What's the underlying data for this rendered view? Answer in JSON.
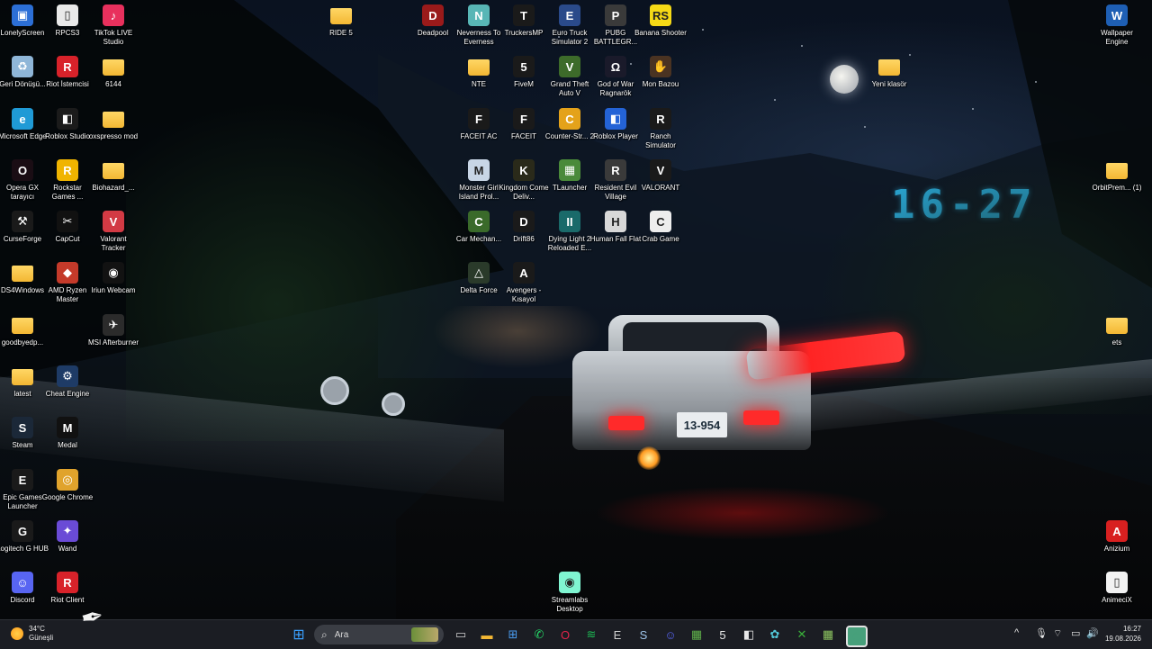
{
  "wallpaper": {
    "clock_widget": "16-27",
    "plate": "13-954"
  },
  "desktop": {
    "icons": [
      {
        "label": "LonelyScreen",
        "icon": "monitor-icon",
        "color": "#2c6fd6",
        "glyph": "▣"
      },
      {
        "label": "RPCS3",
        "icon": "file-icon",
        "color": "#e9e9e9",
        "glyph": "▯"
      },
      {
        "label": "TikTok LIVE Studio",
        "icon": "tiktok-icon",
        "color": "#e8305d",
        "glyph": "♪"
      },
      {
        "label": "Geri Dönüşü...",
        "icon": "recycle-bin-icon",
        "color": "#8fb6d8",
        "glyph": "♻"
      },
      {
        "label": "Riot İstemcisi",
        "icon": "riot-icon",
        "color": "#d8222a",
        "glyph": "R"
      },
      {
        "label": "6144",
        "icon": "folder-icon",
        "color": "#f3b733",
        "glyph": ""
      },
      {
        "label": "Microsoft Edge",
        "icon": "edge-icon",
        "color": "#1f9ad6",
        "glyph": "e"
      },
      {
        "label": "Roblox Studio",
        "icon": "roblox-studio-icon",
        "color": "#1b1b1b",
        "glyph": "◧"
      },
      {
        "label": "oxspresso mod",
        "icon": "folder-icon",
        "color": "#f3b733",
        "glyph": ""
      },
      {
        "label": "Opera GX tarayıcı",
        "icon": "opera-gx-icon",
        "color": "#1a0d14",
        "glyph": "O"
      },
      {
        "label": "Rockstar Games ...",
        "icon": "rockstar-icon",
        "color": "#f0b400",
        "glyph": "R"
      },
      {
        "label": "Biohazard_...",
        "icon": "folder-icon",
        "color": "#f3b733",
        "glyph": ""
      },
      {
        "label": "CurseForge",
        "icon": "curseforge-icon",
        "color": "#1a1a1a",
        "glyph": "⚒"
      },
      {
        "label": "CapCut",
        "icon": "capcut-icon",
        "color": "#111111",
        "glyph": "✂"
      },
      {
        "label": "Valorant Tracker",
        "icon": "valorant-tracker-icon",
        "color": "#d23a44",
        "glyph": "V"
      },
      {
        "label": "DS4Windows",
        "icon": "folder-icon",
        "color": "#f3b733",
        "glyph": ""
      },
      {
        "label": "AMD Ryzen Master",
        "icon": "amd-icon",
        "color": "#c43a2a",
        "glyph": "◆"
      },
      {
        "label": "Iriun Webcam",
        "icon": "webcam-icon",
        "color": "#121212",
        "glyph": "◉"
      },
      {
        "label": "goodbyedp...",
        "icon": "folder-icon",
        "color": "#f3b733",
        "glyph": ""
      },
      {
        "label": "MSI Afterburner",
        "icon": "msi-afterburner-icon",
        "color": "#2b2b2b",
        "glyph": "✈"
      },
      {
        "label": "latest",
        "icon": "folder-icon",
        "color": "#f3b733",
        "glyph": ""
      },
      {
        "label": "Cheat Engine",
        "icon": "cheat-engine-icon",
        "color": "#1e3b66",
        "glyph": "⚙"
      },
      {
        "label": "Steam",
        "icon": "steam-icon",
        "color": "#1b2838",
        "glyph": "S"
      },
      {
        "label": "Medal",
        "icon": "medal-icon",
        "color": "#111111",
        "glyph": "M"
      },
      {
        "label": "Epic Games Launcher",
        "icon": "epic-games-icon",
        "color": "#1a1a1a",
        "glyph": "E"
      },
      {
        "label": "Google Chrome",
        "icon": "chrome-icon",
        "color": "#e0a32c",
        "glyph": "◎"
      },
      {
        "label": "Logitech G HUB",
        "icon": "logitech-icon",
        "color": "#1a1a1a",
        "glyph": "G"
      },
      {
        "label": "Wand",
        "icon": "wand-icon",
        "color": "#6a4bd6",
        "glyph": "✦"
      },
      {
        "label": "Discord",
        "icon": "discord-icon",
        "color": "#5865f2",
        "glyph": "☺"
      },
      {
        "label": "Riot Client",
        "icon": "riot-icon",
        "color": "#d8222a",
        "glyph": "R"
      },
      {
        "label": "RIDE 5",
        "icon": "folder-icon",
        "color": "#f3b733",
        "glyph": ""
      },
      {
        "label": "Deadpool",
        "icon": "deadpool-icon",
        "color": "#9a1a1a",
        "glyph": "D"
      },
      {
        "label": "Neverness To Everness",
        "icon": "nte-icon",
        "color": "#58b6b6",
        "glyph": "N"
      },
      {
        "label": "TruckersMP",
        "icon": "truckersmp-icon",
        "color": "#1a1a1a",
        "glyph": "T"
      },
      {
        "label": "Euro Truck Simulator 2",
        "icon": "ets2-icon",
        "color": "#2a4a8a",
        "glyph": "E"
      },
      {
        "label": "PUBG BATTLEGR...",
        "icon": "pubg-icon",
        "color": "#3a3a3a",
        "glyph": "P"
      },
      {
        "label": "Banana Shooter",
        "icon": "banana-shooter-icon",
        "color": "#f5d916",
        "glyph": "RS"
      },
      {
        "label": "NTE",
        "icon": "folder-icon",
        "color": "#f3b733",
        "glyph": ""
      },
      {
        "label": "FiveM",
        "icon": "fivem-icon",
        "color": "#1a1a1a",
        "glyph": "5"
      },
      {
        "label": "Grand Theft Auto V",
        "icon": "gta5-icon",
        "color": "#3d6b2a",
        "glyph": "V"
      },
      {
        "label": "God of War Ragnarök",
        "icon": "god-of-war-icon",
        "color": "#1a1a2a",
        "glyph": "Ω"
      },
      {
        "label": "Mon Bazou",
        "icon": "mon-bazou-icon",
        "color": "#4a3322",
        "glyph": "✋"
      },
      {
        "label": "FACEIT AC",
        "icon": "faceit-ac-icon",
        "color": "#1a1a1a",
        "glyph": "F"
      },
      {
        "label": "FACEIT",
        "icon": "faceit-icon",
        "color": "#1a1a1a",
        "glyph": "F"
      },
      {
        "label": "Counter-Str... 2",
        "icon": "cs2-icon",
        "color": "#e4a21a",
        "glyph": "C"
      },
      {
        "label": "Roblox Player",
        "icon": "roblox-player-icon",
        "color": "#2463d6",
        "glyph": "◧"
      },
      {
        "label": "Ranch Simulator",
        "icon": "ranch-simulator-icon",
        "color": "#1a1a1a",
        "glyph": "R"
      },
      {
        "label": "Monster Girl Island Prol...",
        "icon": "monster-girl-icon",
        "color": "#c8d6e6",
        "glyph": "M"
      },
      {
        "label": "Kingdom Come Deliv...",
        "icon": "kingdom-come-icon",
        "color": "#2a2a1a",
        "glyph": "K"
      },
      {
        "label": "TLauncher",
        "icon": "tlauncher-icon",
        "color": "#4a8a3a",
        "glyph": "▦"
      },
      {
        "label": "Resident Evil Village",
        "icon": "resident-evil-icon",
        "color": "#3a3a3a",
        "glyph": "R"
      },
      {
        "label": "VALORANT",
        "icon": "valorant-icon",
        "color": "#1a1a1a",
        "glyph": "V"
      },
      {
        "label": "Car Mechan...",
        "icon": "car-mechanic-icon",
        "color": "#3a6a2a",
        "glyph": "C"
      },
      {
        "label": "Drift86",
        "icon": "drift86-icon",
        "color": "#1a1a1a",
        "glyph": "D"
      },
      {
        "label": "Dying Light 2 Reloaded E...",
        "icon": "dying-light-icon",
        "color": "#1a6a6a",
        "glyph": "II"
      },
      {
        "label": "Human Fall Flat",
        "icon": "human-fall-flat-icon",
        "color": "#d8d8d8",
        "glyph": "H"
      },
      {
        "label": "Crab Game",
        "icon": "crab-game-icon",
        "color": "#ededed",
        "glyph": "C"
      },
      {
        "label": "Delta Force",
        "icon": "delta-force-icon",
        "color": "#2a3a2a",
        "glyph": "△"
      },
      {
        "label": "Avengers - Kısayol",
        "icon": "avengers-icon",
        "color": "#1a1a1a",
        "glyph": "A"
      },
      {
        "label": "Streamlabs Desktop",
        "icon": "streamlabs-icon",
        "color": "#80f5d2",
        "glyph": "◉"
      },
      {
        "label": "Yeni klasör",
        "icon": "folder-icon",
        "color": "#f3b733",
        "glyph": ""
      },
      {
        "label": "Wallpaper Engine",
        "icon": "wallpaper-engine-icon",
        "color": "#1e5fb4",
        "glyph": "W"
      },
      {
        "label": "OrbitPrem... (1)",
        "icon": "folder-icon",
        "color": "#f3b733",
        "glyph": ""
      },
      {
        "label": "ets",
        "icon": "folder-icon",
        "color": "#f3b733",
        "glyph": ""
      },
      {
        "label": "Anizium",
        "icon": "anizium-icon",
        "color": "#d82020",
        "glyph": "A"
      },
      {
        "label": "AnimeciX",
        "icon": "file-icon",
        "color": "#f2f2f2",
        "glyph": "▯"
      }
    ]
  },
  "taskbar": {
    "weather": {
      "temp": "34°C",
      "condition": "Güneşli"
    },
    "search": {
      "placeholder": "Ara"
    },
    "apps": [
      {
        "name": "start-button",
        "glyph": "⊞",
        "color": "#3aa0ff"
      },
      {
        "name": "task-view-button",
        "glyph": "▭",
        "color": "#cfcfcf"
      },
      {
        "name": "file-explorer-button",
        "glyph": "▬",
        "color": "#f3b733"
      },
      {
        "name": "microsoft-store-button",
        "glyph": "⊞",
        "color": "#4a9cf0"
      },
      {
        "name": "whatsapp-button",
        "glyph": "✆",
        "color": "#25d366"
      },
      {
        "name": "opera-gx-button",
        "glyph": "O",
        "color": "#e0244a"
      },
      {
        "name": "spotify-button",
        "glyph": "≋",
        "color": "#1db954"
      },
      {
        "name": "epic-games-button",
        "glyph": "E",
        "color": "#cfcfcf"
      },
      {
        "name": "steam-button",
        "glyph": "S",
        "color": "#9ec4e8"
      },
      {
        "name": "discord-button",
        "glyph": "☺",
        "color": "#5865f2"
      },
      {
        "name": "minecraft-button",
        "glyph": "▦",
        "color": "#5fb04a"
      },
      {
        "name": "fivem-button",
        "glyph": "5",
        "color": "#e8e8e8"
      },
      {
        "name": "roblox-button",
        "glyph": "◧",
        "color": "#e8e8e8"
      },
      {
        "name": "xbox-app-button",
        "glyph": "✿",
        "color": "#52c8d8"
      },
      {
        "name": "xbox-button",
        "glyph": "✕",
        "color": "#3ab03a"
      },
      {
        "name": "tlauncher-button",
        "glyph": "▦",
        "color": "#8cc460"
      },
      {
        "name": "streamlabs-button",
        "glyph": "◉",
        "color": "#47a07b"
      }
    ],
    "tray": {
      "chevron": "^",
      "mic": "🎙",
      "wifi": "⌔",
      "battery": "▭",
      "volume": "🔊"
    },
    "clock": {
      "time": "16:27",
      "date": "19.08.2026"
    }
  }
}
